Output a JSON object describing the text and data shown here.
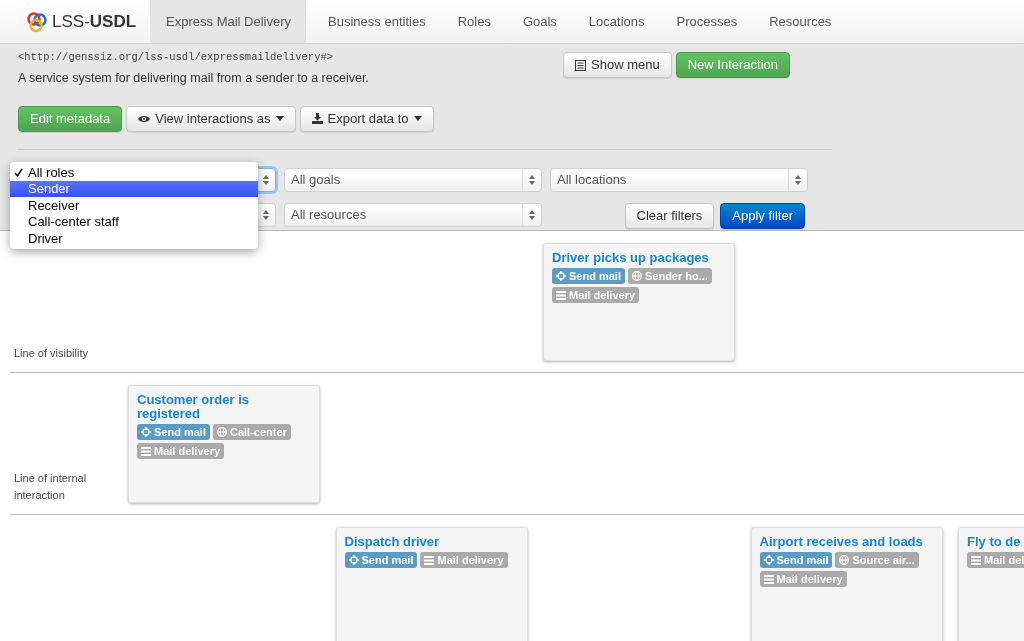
{
  "navbar": {
    "logo": "LSS-**USDL**",
    "tabs": [
      {
        "label": "Express Mail Delivery",
        "selected": true
      },
      {
        "label": "Business entities",
        "selected": false
      },
      {
        "label": "Roles",
        "selected": false
      },
      {
        "label": "Goals",
        "selected": false
      },
      {
        "label": "Locations",
        "selected": false
      },
      {
        "label": "Processes",
        "selected": false
      },
      {
        "label": "Resources",
        "selected": false
      }
    ]
  },
  "header": {
    "uri": "<http://genssiz.org/lss-usdl/expressmaildelivery#>",
    "description": "A service system for delivering mail from a sender to a receiver.",
    "actions": [
      {
        "label": "Show menu",
        "kind": "menu"
      },
      {
        "label": "New Interaction",
        "kind": "success"
      }
    ],
    "toolbar": [
      {
        "label": "Edit metadata",
        "kind": "success"
      },
      {
        "label": "View interactions as",
        "kind": "view"
      },
      {
        "label": "Export data to",
        "kind": "export"
      }
    ]
  },
  "filters": {
    "row_1": [
      {
        "focused": true
      },
      {
        "value": "All goals",
        "focused": false
      },
      {
        "value": "All locations",
        "focused": false
      }
    ],
    "row_2": [
      {
        "focused": false
      },
      {
        "value": "All resources",
        "focused": false
      }
    ],
    "buttons": [
      {
        "label": "Clear filters",
        "kind": "default"
      },
      {
        "label": "Apply filter",
        "kind": "primary"
      }
    ]
  },
  "roles_menu": {
    "items": [
      {
        "label": "All roles",
        "checked": true,
        "highlighted": false
      },
      {
        "label": "Sender",
        "checked": false,
        "highlighted": true
      },
      {
        "label": "Receiver",
        "checked": false,
        "highlighted": false
      },
      {
        "label": "Call-center staff",
        "checked": false,
        "highlighted": false
      },
      {
        "label": "Driver",
        "checked": false,
        "highlighted": false
      }
    ]
  },
  "lanes": [
    {
      "label": "Line of visibility",
      "slots": [
        {
          "kind": "empty"
        },
        {
          "kind": "empty"
        },
        {
          "kind": "card",
          "title": "Driver picks up packages",
          "tags": [
            {
              "kind": "goal",
              "label": "Send mail"
            },
            {
              "kind": "location",
              "label": "Sender ho..."
            },
            {
              "kind": "resource",
              "label": "Mail delivery"
            }
          ]
        }
      ]
    },
    {
      "label": "Line of internal interaction",
      "slots": [
        {
          "kind": "card",
          "title": "Customer order is registered",
          "tags": [
            {
              "kind": "goal",
              "label": "Send mail"
            },
            {
              "kind": "location",
              "label": "Call-center"
            },
            {
              "kind": "resource",
              "label": "Mail delivery"
            }
          ]
        }
      ]
    },
    {
      "slots": [
        {
          "kind": "empty"
        },
        {
          "kind": "card",
          "title": "Dispatch driver",
          "tags": [
            {
              "kind": "goal",
              "label": "Send mail"
            },
            {
              "kind": "resource",
              "label": "Mail delivery"
            }
          ]
        },
        {
          "kind": "empty"
        },
        {
          "kind": "card",
          "title": "Airport receives and loads",
          "tags": [
            {
              "kind": "goal",
              "label": "Send mail"
            },
            {
              "kind": "location",
              "label": "Source air..."
            },
            {
              "kind": "resource",
              "label": "Mail delivery"
            }
          ]
        },
        {
          "kind": "card",
          "title": "Fly to de",
          "tags": [
            {
              "kind": "resource",
              "label": "Mail del"
            }
          ]
        }
      ]
    }
  ]
}
